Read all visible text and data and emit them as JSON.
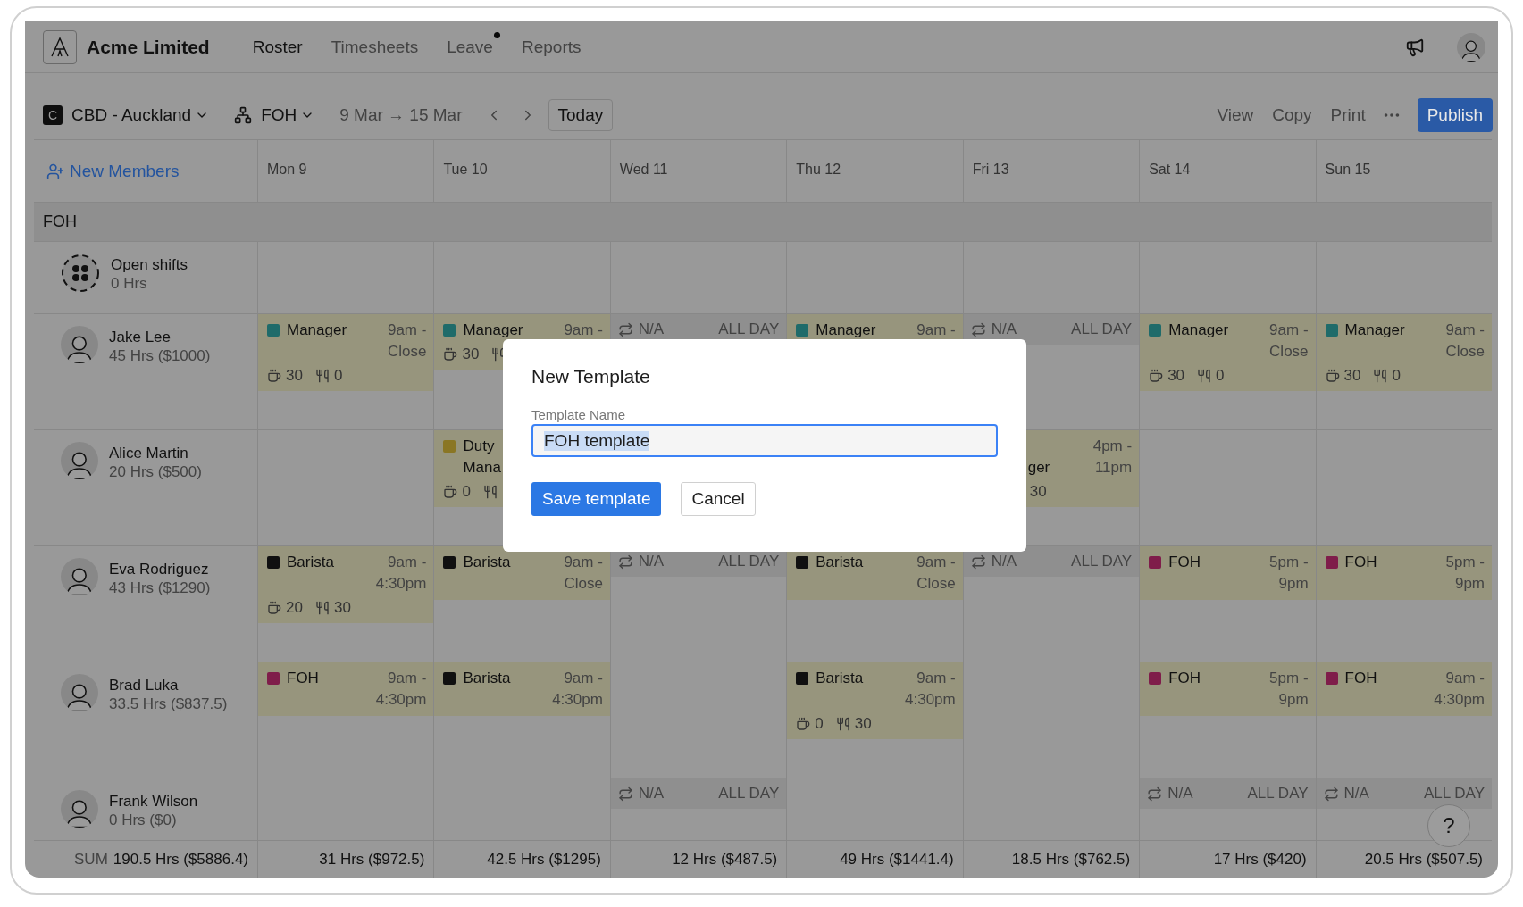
{
  "app": {
    "name": "Acme Limited"
  },
  "nav": [
    {
      "label": "Roster",
      "selected": true,
      "dot": false
    },
    {
      "label": "Timesheets",
      "selected": false,
      "dot": false
    },
    {
      "label": "Leave",
      "selected": false,
      "dot": true
    },
    {
      "label": "Reports",
      "selected": false,
      "dot": false
    }
  ],
  "toolbar": {
    "location_badge": "C",
    "location": "CBD - Auckland",
    "team": "FOH",
    "date_range": "9 Mar → 15 Mar",
    "today": "Today",
    "actions": [
      "View",
      "Copy",
      "Print"
    ],
    "publish": "Publish"
  },
  "roster": {
    "new_members": "New Members",
    "days": [
      "Mon 9",
      "Tue 10",
      "Wed 11",
      "Thu 12",
      "Fri 13",
      "Sat 14",
      "Sun 15"
    ],
    "group": "FOH",
    "rows": [
      {
        "kind": "open",
        "name": "Open shifts",
        "hours": "0 Hrs",
        "cells": [
          null,
          null,
          null,
          null,
          null,
          null,
          null
        ]
      },
      {
        "kind": "person",
        "name": "Jake Lee",
        "hours": "45 Hrs ($1000)",
        "cells": [
          {
            "kind": "shift",
            "color": "#1f6b6a",
            "role": [
              "Manager"
            ],
            "time": [
              "9am -",
              "Close"
            ],
            "breaks": [
              {
                "kind": "tea",
                "value": "30"
              },
              {
                "kind": "meal",
                "value": "0"
              }
            ]
          },
          {
            "kind": "shift",
            "color": "#1f6b6a",
            "role": [
              "Manager"
            ],
            "time": [
              "9am -"
            ],
            "breaks": [
              {
                "kind": "tea",
                "value": "30"
              },
              {
                "kind": "meal"
              }
            ]
          },
          {
            "kind": "na",
            "label": "N/A",
            "period": "ALL DAY"
          },
          {
            "kind": "shift",
            "color": "#1f6b6a",
            "role": [
              "Manager"
            ],
            "time": [
              "9am -"
            ]
          },
          {
            "kind": "na",
            "label": "N/A",
            "period": "ALL DAY"
          },
          {
            "kind": "shift",
            "color": "#1f6b6a",
            "role": [
              "Manager"
            ],
            "time": [
              "9am -",
              "Close"
            ],
            "breaks": [
              {
                "kind": "tea",
                "value": "30"
              },
              {
                "kind": "meal",
                "value": "0"
              }
            ]
          },
          {
            "kind": "shift",
            "color": "#1f6b6a",
            "role": [
              "Manager"
            ],
            "time": [
              "9am -",
              "Close"
            ],
            "breaks": [
              {
                "kind": "tea",
                "value": "30"
              },
              {
                "kind": "meal",
                "value": "0"
              }
            ]
          }
        ]
      },
      {
        "kind": "person",
        "name": "Alice Martin",
        "hours": "20 Hrs ($500)",
        "cells": [
          null,
          {
            "kind": "shift",
            "color": "#8a7624",
            "role": [
              "Duty",
              "Mana"
            ],
            "breaks": [
              {
                "kind": "tea",
                "value": "0"
              },
              {
                "kind": "meal"
              }
            ]
          },
          null,
          null,
          {
            "kind": "shift_tail",
            "role": [
              "ger"
            ],
            "time": [
              "4pm -",
              "11pm"
            ],
            "breaks": [
              {
                "value": "30"
              }
            ]
          },
          null,
          null
        ]
      },
      {
        "kind": "person",
        "name": "Eva Rodriguez",
        "hours": "43 Hrs ($1290)",
        "cells": [
          {
            "kind": "shift",
            "color": "#101010",
            "role": [
              "Barista"
            ],
            "time": [
              "9am -",
              "4:30pm"
            ],
            "breaks": [
              {
                "kind": "tea",
                "value": "20"
              },
              {
                "kind": "meal",
                "value": "30"
              }
            ]
          },
          {
            "kind": "shift",
            "color": "#101010",
            "role": [
              "Barista"
            ],
            "time": [
              "9am -",
              "Close"
            ]
          },
          {
            "kind": "na",
            "label": "N/A",
            "period": "ALL DAY"
          },
          {
            "kind": "shift",
            "color": "#101010",
            "role": [
              "Barista"
            ],
            "time": [
              "9am -",
              "Close"
            ]
          },
          {
            "kind": "na",
            "label": "N/A",
            "period": "ALL DAY"
          },
          {
            "kind": "shift",
            "color": "#7f1d4a",
            "role": [
              "FOH"
            ],
            "time": [
              "5pm -",
              "9pm"
            ]
          },
          {
            "kind": "shift",
            "color": "#7f1d4a",
            "role": [
              "FOH"
            ],
            "time": [
              "5pm -",
              "9pm"
            ]
          }
        ]
      },
      {
        "kind": "person",
        "name": "Brad Luka",
        "hours": "33.5 Hrs ($837.5)",
        "cells": [
          {
            "kind": "shift",
            "color": "#7f1d4a",
            "role": [
              "FOH"
            ],
            "time": [
              "9am -",
              "4:30pm"
            ]
          },
          {
            "kind": "shift",
            "color": "#101010",
            "role": [
              "Barista"
            ],
            "time": [
              "9am -",
              "4:30pm"
            ]
          },
          null,
          {
            "kind": "shift",
            "color": "#101010",
            "role": [
              "Barista"
            ],
            "time": [
              "9am -",
              "4:30pm"
            ],
            "breaks": [
              {
                "kind": "tea",
                "value": "0"
              },
              {
                "kind": "meal",
                "value": "30"
              }
            ]
          },
          null,
          {
            "kind": "shift",
            "color": "#7f1d4a",
            "role": [
              "FOH"
            ],
            "time": [
              "5pm -",
              "9pm"
            ]
          },
          {
            "kind": "shift",
            "color": "#7f1d4a",
            "role": [
              "FOH"
            ],
            "time": [
              "9am -",
              "4:30pm"
            ]
          }
        ]
      },
      {
        "kind": "person",
        "name": "Frank Wilson",
        "hours": "0 Hrs ($0)",
        "cells": [
          null,
          null,
          {
            "kind": "na",
            "label": "N/A",
            "period": "ALL DAY"
          },
          null,
          null,
          {
            "kind": "na",
            "label": "N/A",
            "period": "ALL DAY"
          },
          {
            "kind": "na",
            "label": "N/A",
            "period": "ALL DAY"
          }
        ]
      }
    ],
    "sum": {
      "label": "SUM",
      "total": "190.5 Hrs ($5886.4)",
      "days": [
        "31 Hrs ($972.5)",
        "42.5 Hrs ($1295)",
        "12 Hrs ($487.5)",
        "49 Hrs ($1441.4)",
        "18.5 Hrs ($762.5)",
        "17 Hrs ($420)",
        "20.5 Hrs ($507.5)"
      ]
    }
  },
  "help": "?",
  "dialog": {
    "title": "New Template",
    "field_label": "Template Name",
    "value": "FOH template",
    "save": "Save template",
    "cancel": "Cancel"
  }
}
